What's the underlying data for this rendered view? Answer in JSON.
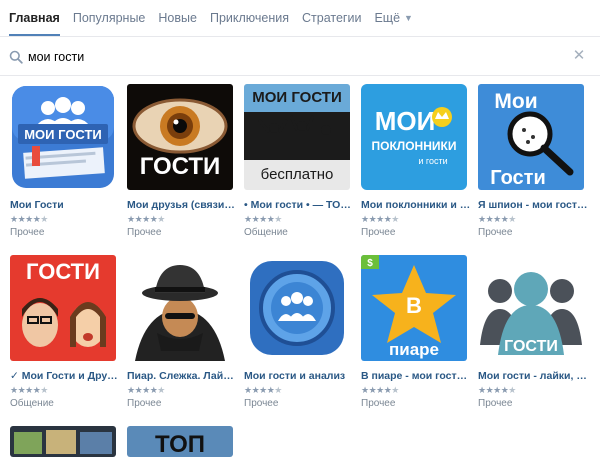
{
  "tabs": [
    {
      "label": "Главная",
      "active": true
    },
    {
      "label": "Популярные",
      "active": false
    },
    {
      "label": "Новые",
      "active": false
    },
    {
      "label": "Приключения",
      "active": false
    },
    {
      "label": "Стратегии",
      "active": false
    },
    {
      "label": "Ещё",
      "active": false
    }
  ],
  "search": {
    "value": "мои гости",
    "placeholder": ""
  },
  "colors": {
    "accent": "#5181b8",
    "link": "#2a5885",
    "muted": "#7b8794"
  },
  "apps": [
    {
      "title": "Мои Гости",
      "rating": 4,
      "category": "Прочее",
      "thumb_text": "МОИ ГОСТИ",
      "icon": "users-icon"
    },
    {
      "title": "Мои друзья (связи, г...",
      "rating": 4,
      "category": "Прочее",
      "thumb_text": "ГОСТИ",
      "icon": "eye-icon"
    },
    {
      "title": "• Мои гости • — ТОП ...",
      "rating": 4,
      "category": "Общение",
      "thumb_text_top": "МОИ ГОСТИ",
      "thumb_text_bottom": "бесплатно",
      "icon": "people-silhouette-icon"
    },
    {
      "title": "Мои поклонники и го...",
      "rating": 4,
      "category": "Прочее",
      "thumb_text_top": "МОИ",
      "thumb_text_mid": "ПОКЛОННИКИ",
      "thumb_text_bottom": "и гости",
      "icon": "crown-icon"
    },
    {
      "title": "Я шпион - мои гости, ...",
      "rating": 4,
      "category": "Прочее",
      "thumb_text_top": "Мои",
      "thumb_text_bottom": "Гости",
      "icon": "magnifier-icon"
    },
    {
      "title": "✓ Мои Гости и Друзья",
      "rating": 4,
      "category": "Общение",
      "thumb_text": "ГОСТИ",
      "icon": "faces-icon"
    },
    {
      "title": "Пиар. Слежка. Лайк...",
      "rating": 4,
      "category": "Прочее",
      "icon": "spy-icon"
    },
    {
      "title": "Мои гости и анализ",
      "rating": 4,
      "category": "Прочее",
      "icon": "group-icon"
    },
    {
      "title": "В пиаре - мои гости, ...",
      "rating": 4,
      "category": "Прочее",
      "thumb_text_badge": "В",
      "thumb_text_bottom": "пиаре",
      "icon": "star-icon"
    },
    {
      "title": "Мои гости - лайки, д...",
      "rating": 4,
      "category": "Прочее",
      "thumb_text": "ГОСТИ",
      "icon": "group-silhouette-icon"
    },
    {
      "title": "",
      "rating": 0,
      "category": "",
      "icon": "photo-stack-icon"
    },
    {
      "title": "",
      "rating": 0,
      "category": "",
      "thumb_text": "ТОП",
      "icon": "top-icon"
    }
  ]
}
